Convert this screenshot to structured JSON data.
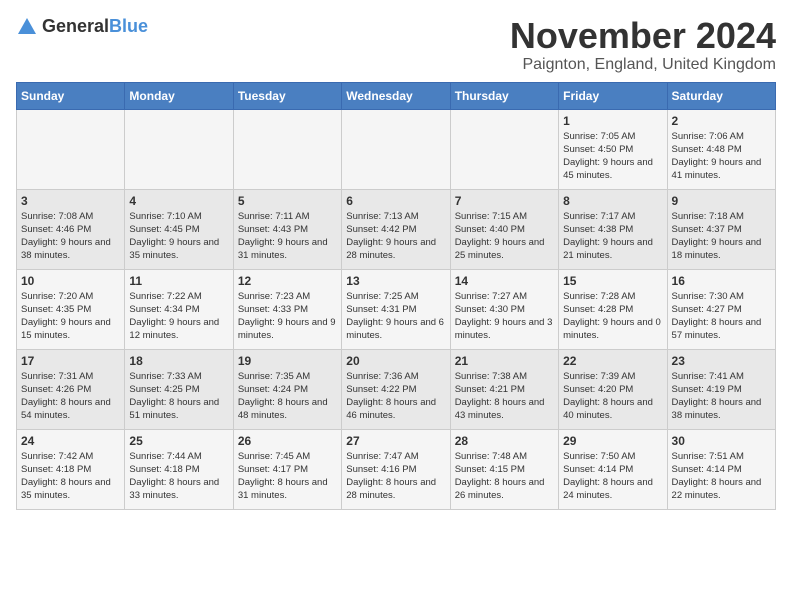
{
  "logo": {
    "text_general": "General",
    "text_blue": "Blue"
  },
  "title": "November 2024",
  "location": "Paignton, England, United Kingdom",
  "days_of_week": [
    "Sunday",
    "Monday",
    "Tuesday",
    "Wednesday",
    "Thursday",
    "Friday",
    "Saturday"
  ],
  "weeks": [
    [
      {
        "day": "",
        "info": ""
      },
      {
        "day": "",
        "info": ""
      },
      {
        "day": "",
        "info": ""
      },
      {
        "day": "",
        "info": ""
      },
      {
        "day": "",
        "info": ""
      },
      {
        "day": "1",
        "info": "Sunrise: 7:05 AM\nSunset: 4:50 PM\nDaylight: 9 hours and 45 minutes."
      },
      {
        "day": "2",
        "info": "Sunrise: 7:06 AM\nSunset: 4:48 PM\nDaylight: 9 hours and 41 minutes."
      }
    ],
    [
      {
        "day": "3",
        "info": "Sunrise: 7:08 AM\nSunset: 4:46 PM\nDaylight: 9 hours and 38 minutes."
      },
      {
        "day": "4",
        "info": "Sunrise: 7:10 AM\nSunset: 4:45 PM\nDaylight: 9 hours and 35 minutes."
      },
      {
        "day": "5",
        "info": "Sunrise: 7:11 AM\nSunset: 4:43 PM\nDaylight: 9 hours and 31 minutes."
      },
      {
        "day": "6",
        "info": "Sunrise: 7:13 AM\nSunset: 4:42 PM\nDaylight: 9 hours and 28 minutes."
      },
      {
        "day": "7",
        "info": "Sunrise: 7:15 AM\nSunset: 4:40 PM\nDaylight: 9 hours and 25 minutes."
      },
      {
        "day": "8",
        "info": "Sunrise: 7:17 AM\nSunset: 4:38 PM\nDaylight: 9 hours and 21 minutes."
      },
      {
        "day": "9",
        "info": "Sunrise: 7:18 AM\nSunset: 4:37 PM\nDaylight: 9 hours and 18 minutes."
      }
    ],
    [
      {
        "day": "10",
        "info": "Sunrise: 7:20 AM\nSunset: 4:35 PM\nDaylight: 9 hours and 15 minutes."
      },
      {
        "day": "11",
        "info": "Sunrise: 7:22 AM\nSunset: 4:34 PM\nDaylight: 9 hours and 12 minutes."
      },
      {
        "day": "12",
        "info": "Sunrise: 7:23 AM\nSunset: 4:33 PM\nDaylight: 9 hours and 9 minutes."
      },
      {
        "day": "13",
        "info": "Sunrise: 7:25 AM\nSunset: 4:31 PM\nDaylight: 9 hours and 6 minutes."
      },
      {
        "day": "14",
        "info": "Sunrise: 7:27 AM\nSunset: 4:30 PM\nDaylight: 9 hours and 3 minutes."
      },
      {
        "day": "15",
        "info": "Sunrise: 7:28 AM\nSunset: 4:28 PM\nDaylight: 9 hours and 0 minutes."
      },
      {
        "day": "16",
        "info": "Sunrise: 7:30 AM\nSunset: 4:27 PM\nDaylight: 8 hours and 57 minutes."
      }
    ],
    [
      {
        "day": "17",
        "info": "Sunrise: 7:31 AM\nSunset: 4:26 PM\nDaylight: 8 hours and 54 minutes."
      },
      {
        "day": "18",
        "info": "Sunrise: 7:33 AM\nSunset: 4:25 PM\nDaylight: 8 hours and 51 minutes."
      },
      {
        "day": "19",
        "info": "Sunrise: 7:35 AM\nSunset: 4:24 PM\nDaylight: 8 hours and 48 minutes."
      },
      {
        "day": "20",
        "info": "Sunrise: 7:36 AM\nSunset: 4:22 PM\nDaylight: 8 hours and 46 minutes."
      },
      {
        "day": "21",
        "info": "Sunrise: 7:38 AM\nSunset: 4:21 PM\nDaylight: 8 hours and 43 minutes."
      },
      {
        "day": "22",
        "info": "Sunrise: 7:39 AM\nSunset: 4:20 PM\nDaylight: 8 hours and 40 minutes."
      },
      {
        "day": "23",
        "info": "Sunrise: 7:41 AM\nSunset: 4:19 PM\nDaylight: 8 hours and 38 minutes."
      }
    ],
    [
      {
        "day": "24",
        "info": "Sunrise: 7:42 AM\nSunset: 4:18 PM\nDaylight: 8 hours and 35 minutes."
      },
      {
        "day": "25",
        "info": "Sunrise: 7:44 AM\nSunset: 4:18 PM\nDaylight: 8 hours and 33 minutes."
      },
      {
        "day": "26",
        "info": "Sunrise: 7:45 AM\nSunset: 4:17 PM\nDaylight: 8 hours and 31 minutes."
      },
      {
        "day": "27",
        "info": "Sunrise: 7:47 AM\nSunset: 4:16 PM\nDaylight: 8 hours and 28 minutes."
      },
      {
        "day": "28",
        "info": "Sunrise: 7:48 AM\nSunset: 4:15 PM\nDaylight: 8 hours and 26 minutes."
      },
      {
        "day": "29",
        "info": "Sunrise: 7:50 AM\nSunset: 4:14 PM\nDaylight: 8 hours and 24 minutes."
      },
      {
        "day": "30",
        "info": "Sunrise: 7:51 AM\nSunset: 4:14 PM\nDaylight: 8 hours and 22 minutes."
      }
    ]
  ]
}
